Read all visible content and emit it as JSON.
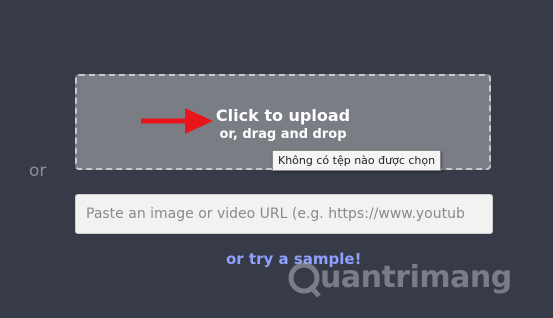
{
  "sidebar": {
    "or_label": "or"
  },
  "upload": {
    "title": "Click to upload",
    "subtitle": "or, drag and drop",
    "tooltip": "Không có tệp nào được chọn"
  },
  "url_input": {
    "placeholder": "Paste an image or video URL (e.g. https://www.youtub",
    "value": ""
  },
  "sample": {
    "label": "or try a sample!"
  },
  "watermark": {
    "text": "uantrimang"
  },
  "colors": {
    "background": "#363b47",
    "dropzone": "#7a7d84",
    "link": "#8fa0ff",
    "arrow": "#e8161a"
  },
  "icons": {
    "arrow": "red-arrow-right-icon",
    "watermark_logo": "quantrimang-logo-icon"
  }
}
